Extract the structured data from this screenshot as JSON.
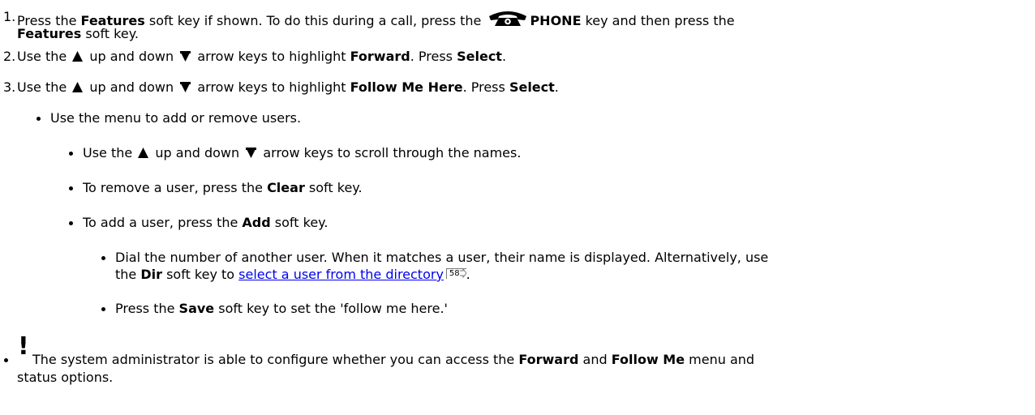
{
  "steps": [
    {
      "number": "1.",
      "line1": {
        "t1": "Press the ",
        "b1": "Features",
        "t2": " soft key if shown. To do this during a call, press the ",
        "phone_icon": "phone-icon",
        "b2": "PHONE",
        "t3": " key and then press the"
      },
      "line2": {
        "b1": "Features",
        "t1": " soft key."
      }
    },
    {
      "number": "2.",
      "t1": "Use the ",
      "up_icon": "up-arrow-icon",
      "t2": " up and down ",
      "down_icon": "down-arrow-icon",
      "t3": " arrow keys to highlight ",
      "b1": "Forward",
      "t4": ". Press ",
      "b2": "Select",
      "t5": "."
    },
    {
      "number": "3.",
      "t1": "Use the ",
      "t2": " up and down ",
      "t3": " arrow keys to highlight ",
      "b1": "Follow Me Here",
      "t4": ". Press ",
      "b2": "Select",
      "t5": "."
    }
  ],
  "bullets": {
    "menu": "Use the menu to add or remove users.",
    "scroll": {
      "t1": "Use the ",
      "t2": " up and down ",
      "t3": " arrow keys to scroll through the names."
    },
    "remove": {
      "t1": "To remove a user, press the ",
      "b1": "Clear",
      "t2": " soft key."
    },
    "add": {
      "t1": "To add a user, press the ",
      "b1": "Add",
      "t2": " soft key."
    },
    "dial": {
      "line1": "Dial the number of another user. When it matches a user, their name is displayed.  Alternatively, use",
      "t1": "the ",
      "b1": "Dir",
      "t2": " soft key to ",
      "link": "select a user from the directory",
      "ref": "58",
      "t3": "."
    },
    "save": {
      "t1": "Press the ",
      "b1": "Save",
      "t2": " soft key to set the 'follow me here.'"
    }
  },
  "note": {
    "icon": "exclamation-icon",
    "mark": "!",
    "t1": "The system administrator is able to configure whether you can access the ",
    "b1": "Forward",
    "t2": " and ",
    "b2": "Follow Me",
    "t3": " menu and",
    "line2": "status options."
  }
}
